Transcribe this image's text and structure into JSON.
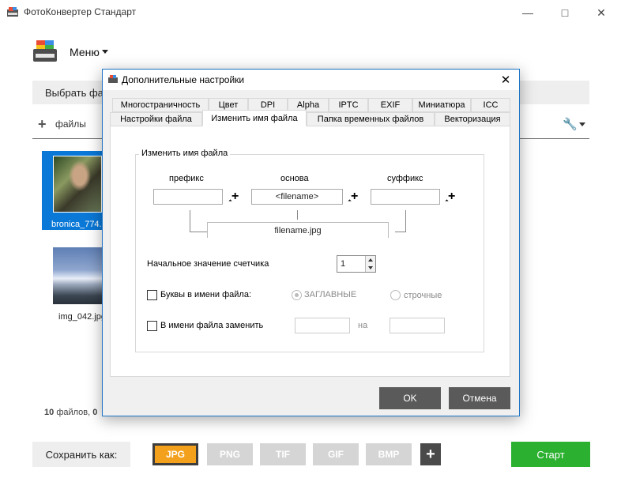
{
  "app": {
    "title": "ФотоКонвертер Стандарт",
    "menu_label": "Меню",
    "select_files_label": "Выбрать фа",
    "add_files_label": "файлы",
    "files": [
      {
        "name": "bronica_774.",
        "selected": true
      },
      {
        "name": "img_042.jpg",
        "selected": false
      }
    ],
    "status_count": "10",
    "status_text": "файлов,",
    "status_tail": "0",
    "save_as_label": "Сохранить как:",
    "formats": [
      "JPG",
      "PNG",
      "TIF",
      "GIF",
      "BMP"
    ],
    "active_format": "JPG",
    "start_label": "Старт"
  },
  "dialog": {
    "title": "Дополнительные настройки",
    "tabs_row1": [
      "Многостраничность",
      "Цвет",
      "DPI",
      "Alpha",
      "IPTC",
      "EXIF",
      "Миниатюра",
      "ICC"
    ],
    "tabs_row2": [
      "Настройки файла",
      "Изменить имя файла",
      "Папка временных файлов",
      "Векторизация"
    ],
    "active_tab": "Изменить имя файла",
    "group_title": "Изменить имя файла",
    "prefix_label": "префикс",
    "base_label": "основа",
    "suffix_label": "суффикс",
    "prefix_value": "",
    "base_value": "<filename>",
    "suffix_value": "",
    "preview": "filename.jpg",
    "counter_label": "Начальное значение счетчика",
    "counter_value": "1",
    "letters_label": "Буквы в имени файла:",
    "letters_checked": false,
    "upper_label": "ЗАГЛАВНЫЕ",
    "lower_label": "строчные",
    "replace_label": "В имени файла заменить",
    "replace_checked": false,
    "replace_from": "",
    "replace_to": "",
    "replace_on_label": "на",
    "ok_label": "OK",
    "cancel_label": "Отмена"
  },
  "colors": {
    "accent_blue": "#0a78d7",
    "active_format": "#f3a01d",
    "start_green": "#2bb030",
    "dialog_button": "#5a5a5a"
  }
}
